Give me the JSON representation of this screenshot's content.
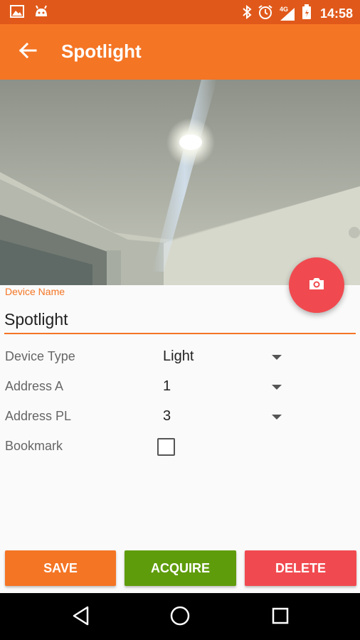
{
  "status_bar": {
    "time": "14:58",
    "network": "4G",
    "left_icons": [
      "image-icon",
      "android-icon"
    ],
    "right_icons": [
      "bluetooth-icon",
      "alarm-icon",
      "signal-icon",
      "battery-icon"
    ]
  },
  "app_bar": {
    "title": "Spotlight",
    "back_icon": "arrow-back-icon",
    "color": "#f47524"
  },
  "form": {
    "device_name_label": "Device Name",
    "device_name_value": "Spotlight",
    "device_type_label": "Device Type",
    "device_type_value": "Light",
    "address_a_label": "Address A",
    "address_a_value": "1",
    "address_pl_label": "Address PL",
    "address_pl_value": "3",
    "bookmark_label": "Bookmark",
    "bookmark_checked": false
  },
  "fab": {
    "icon": "camera-icon",
    "color": "#f04a50"
  },
  "buttons": {
    "save": "SAVE",
    "acquire": "ACQUIRE",
    "delete": "DELETE",
    "save_color": "#f47524",
    "acquire_color": "#5f9c0c",
    "delete_color": "#f04a50"
  },
  "nav_bar": {
    "icons": [
      "back-triangle-icon",
      "home-circle-icon",
      "recents-square-icon"
    ]
  }
}
